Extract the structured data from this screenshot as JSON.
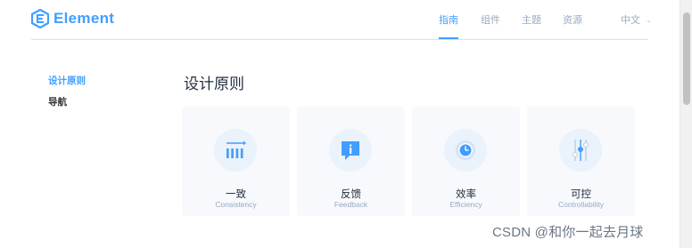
{
  "header": {
    "logo_text": "Element",
    "nav": [
      {
        "label": "指南",
        "active": true
      },
      {
        "label": "组件",
        "active": false
      },
      {
        "label": "主题",
        "active": false
      },
      {
        "label": "资源",
        "active": false
      }
    ],
    "language": "中文"
  },
  "sidebar": {
    "items": [
      {
        "label": "设计原则",
        "active": true
      },
      {
        "label": "导航",
        "active": false
      }
    ]
  },
  "main": {
    "title": "设计原则",
    "cards": [
      {
        "title": "一致",
        "subtitle": "Consistency",
        "icon": "consistency-icon"
      },
      {
        "title": "反馈",
        "subtitle": "Feedback",
        "icon": "feedback-icon"
      },
      {
        "title": "效率",
        "subtitle": "Efficiency",
        "icon": "efficiency-icon"
      },
      {
        "title": "可控",
        "subtitle": "Controllability",
        "icon": "controllability-icon"
      }
    ]
  },
  "watermark": "CSDN @和你一起去月球",
  "colors": {
    "accent": "#409eff",
    "muted": "#99a9bf",
    "card_bg": "#f7f9fc",
    "icon_bg": "#eaf2fb"
  }
}
